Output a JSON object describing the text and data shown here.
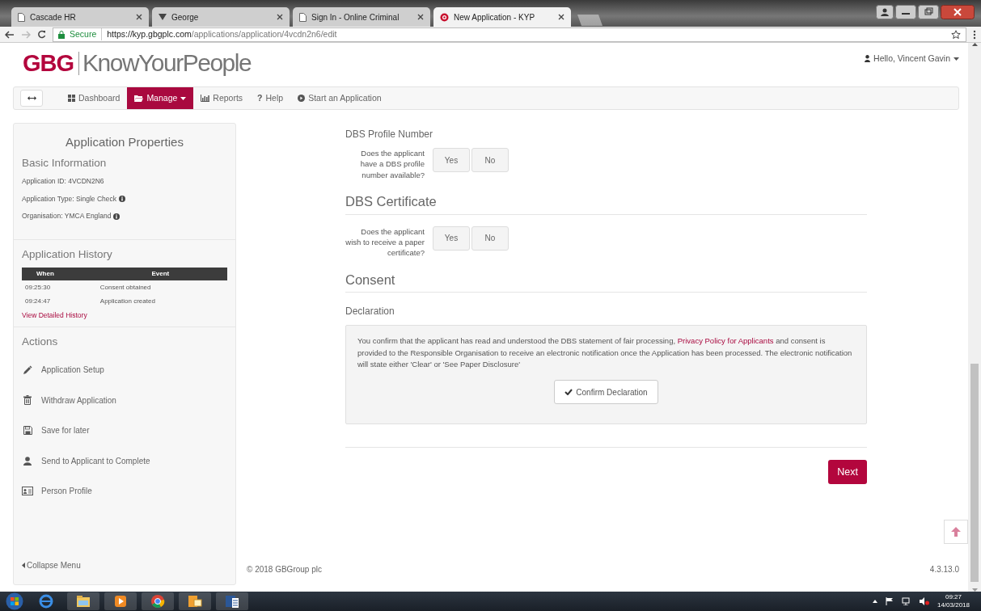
{
  "browser": {
    "tabs": [
      {
        "title": "Cascade HR",
        "selected": false
      },
      {
        "title": "George",
        "selected": false
      },
      {
        "title": "Sign In - Online Criminal",
        "selected": false
      },
      {
        "title": "New Application - KYP",
        "selected": true
      }
    ],
    "secure_label": "Secure",
    "url_host": "https://kyp.gbgplc.com",
    "url_path": "/applications/application/4vcdn2n6/edit"
  },
  "header": {
    "logo_mark": "GBG",
    "logo_text": "KnowYourPeople",
    "user": "Hello, Vincent Gavin"
  },
  "nav": [
    {
      "kind": "toggle",
      "selected": false
    },
    {
      "kind": "link",
      "label": "Dashboard",
      "selected": false,
      "dropdown": false
    },
    {
      "kind": "link",
      "label": "Manage",
      "selected": true,
      "dropdown": true
    },
    {
      "kind": "link",
      "label": "Reports",
      "selected": false,
      "dropdown": false
    },
    {
      "kind": "link",
      "label": "Help",
      "glyph": "?",
      "selected": false,
      "dropdown": false
    },
    {
      "kind": "link",
      "label": "Start an Application",
      "selected": false,
      "dropdown": false
    }
  ],
  "sidebar": {
    "title": "Application Properties",
    "basic": {
      "heading": "Basic Information",
      "rows": [
        {
          "text": "Application ID: 4VCDN2N6",
          "info": false
        },
        {
          "text": "Application Type: Single Check",
          "info": true
        },
        {
          "text": "Organisation: YMCA England",
          "info": true
        }
      ]
    },
    "history": {
      "heading": "Application History",
      "columns": [
        "When",
        "Event"
      ],
      "rows": [
        {
          "when": "09:25:30",
          "event": "Consent obtained"
        },
        {
          "when": "09:24:47",
          "event": "Application created"
        }
      ],
      "link": "View Detailed History"
    },
    "actions": {
      "heading": "Actions",
      "items": [
        "Application Setup",
        "Withdraw Application",
        "Save for later",
        "Send to Applicant to Complete",
        "Person Profile"
      ]
    },
    "collapse": "Collapse Menu"
  },
  "form": [
    {
      "kind": "field_heading",
      "text": "DBS Profile Number"
    },
    {
      "kind": "question",
      "label": "Does the applicant have a DBS profile number available?",
      "options": [
        {
          "label": "Yes",
          "selected": false
        },
        {
          "label": "No",
          "selected": false
        }
      ]
    },
    {
      "kind": "section_heading",
      "text": "DBS Certificate"
    },
    {
      "kind": "question",
      "label": "Does the applicant wish to receive a paper certificate?",
      "options": [
        {
          "label": "Yes",
          "selected": false
        },
        {
          "label": "No",
          "selected": false
        }
      ]
    },
    {
      "kind": "section_heading",
      "text": "Consent"
    },
    {
      "kind": "field_heading",
      "text": "Declaration"
    },
    {
      "kind": "declaration",
      "before": "You confirm that the applicant has read and understood the DBS statement of fair processing, ",
      "link": "Privacy Policy for Applicants",
      "after": " and consent is provided to the Responsible Organisation to receive an electronic notification once the Application has been processed. The electronic notification will state either 'Clear' or 'See Paper Disclosure'",
      "button": "Confirm Declaration"
    }
  ],
  "next_button": "Next",
  "footer": {
    "copyright": "© 2018 GBGroup plc",
    "version": "4.3.13.0"
  },
  "taskbar": {
    "time": "09:27",
    "date": "14/03/2018"
  }
}
